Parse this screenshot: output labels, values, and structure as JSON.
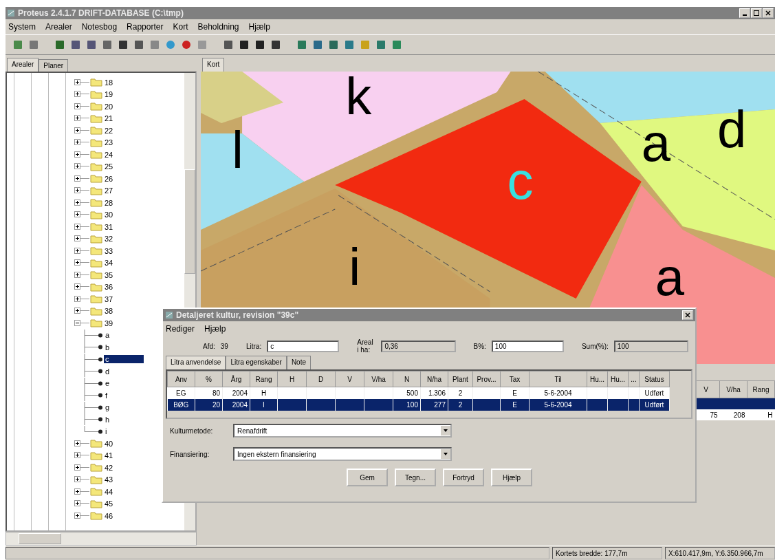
{
  "window": {
    "title": "Proteus 2.4.1.7 DRIFT-DATABASE (C:\\tmp)"
  },
  "menu": [
    "System",
    "Arealer",
    "Notesbog",
    "Rapporter",
    "Kort",
    "Beholdning",
    "Hjælp"
  ],
  "left_tabs": [
    {
      "label": "Arealer",
      "selected": true
    },
    {
      "label": "Planer",
      "selected": false
    }
  ],
  "tree": [
    {
      "label": "18",
      "expanded": false,
      "selected": false
    },
    {
      "label": "19",
      "expanded": false,
      "selected": false
    },
    {
      "label": "20",
      "expanded": false,
      "selected": false
    },
    {
      "label": "21",
      "expanded": false,
      "selected": false
    },
    {
      "label": "22",
      "expanded": false,
      "selected": false
    },
    {
      "label": "23",
      "expanded": false,
      "selected": false
    },
    {
      "label": "24",
      "expanded": false,
      "selected": false
    },
    {
      "label": "25",
      "expanded": false,
      "selected": false
    },
    {
      "label": "26",
      "expanded": false,
      "selected": false
    },
    {
      "label": "27",
      "expanded": false,
      "selected": false
    },
    {
      "label": "28",
      "expanded": false,
      "selected": false
    },
    {
      "label": "30",
      "expanded": false,
      "selected": false
    },
    {
      "label": "31",
      "expanded": false,
      "selected": false
    },
    {
      "label": "32",
      "expanded": false,
      "selected": false
    },
    {
      "label": "33",
      "expanded": false,
      "selected": false
    },
    {
      "label": "34",
      "expanded": false,
      "selected": false
    },
    {
      "label": "35",
      "expanded": false,
      "selected": false
    },
    {
      "label": "36",
      "expanded": false,
      "selected": false
    },
    {
      "label": "37",
      "expanded": false,
      "selected": false
    },
    {
      "label": "38",
      "expanded": false,
      "selected": false
    },
    {
      "label": "39",
      "expanded": true,
      "selected": false,
      "children": [
        {
          "label": "a",
          "selected": false
        },
        {
          "label": "b",
          "selected": false
        },
        {
          "label": "c",
          "selected": true
        },
        {
          "label": "d",
          "selected": false
        },
        {
          "label": "e",
          "selected": false
        },
        {
          "label": "f",
          "selected": false
        },
        {
          "label": "g",
          "selected": false
        },
        {
          "label": "h",
          "selected": false
        },
        {
          "label": "i",
          "selected": false
        }
      ]
    },
    {
      "label": "40",
      "expanded": false,
      "selected": false
    },
    {
      "label": "41",
      "expanded": false,
      "selected": false
    },
    {
      "label": "42",
      "expanded": false,
      "selected": false
    },
    {
      "label": "43",
      "expanded": false,
      "selected": false
    },
    {
      "label": "44",
      "expanded": false,
      "selected": false
    },
    {
      "label": "45",
      "expanded": false,
      "selected": false
    },
    {
      "label": "46",
      "expanded": false,
      "selected": false
    }
  ],
  "map_tabs": [
    {
      "label": "Kort",
      "selected": true
    }
  ],
  "map_labels": [
    "k",
    "l",
    "c",
    "a",
    "d",
    "a",
    "i"
  ],
  "side_table": {
    "columns": [
      "V",
      "V/ha",
      "Rang"
    ],
    "rows": [
      {
        "cells": [
          "",
          "",
          ""
        ],
        "selected": true
      },
      {
        "cells": [
          "75",
          "208",
          "H"
        ],
        "selected": false
      }
    ]
  },
  "dialog": {
    "title": "Detaljeret kultur, revision \"39c\"",
    "menu": [
      "Rediger",
      "Hjælp"
    ],
    "fields": [
      {
        "label": "Afd:",
        "value": "39",
        "kind": "text"
      },
      {
        "label": "Litra:",
        "value": "c",
        "kind": "input"
      },
      {
        "label": "Areal i ha:",
        "value": "0,36",
        "kind": "readonly"
      },
      {
        "label": "B%:",
        "value": "100",
        "kind": "input"
      },
      {
        "label": "Sum(%):",
        "value": "100",
        "kind": "readonly"
      }
    ],
    "tabs": [
      {
        "label": "Litra anvendelse",
        "selected": true
      },
      {
        "label": "Litra egenskaber",
        "selected": false
      },
      {
        "label": "Note",
        "selected": false
      }
    ],
    "table": {
      "columns": [
        "Anv",
        "%",
        "Årg",
        "Rang",
        "H",
        "D",
        "V",
        "V/ha",
        "N",
        "N/ha",
        "Plant",
        "Prov...",
        "Tax",
        "Til",
        "Hu...",
        "Hu...",
        "...",
        "Status"
      ],
      "rows": [
        {
          "cells": [
            "EG",
            "80",
            "2004",
            "H",
            "",
            "",
            "",
            "",
            "500",
            "1.306",
            "2",
            "",
            "E",
            "5-6-2004",
            "",
            "",
            "",
            "Udført"
          ],
          "selected": false
        },
        {
          "cells": [
            "BØG",
            "20",
            "2004",
            "I",
            "",
            "",
            "",
            "",
            "100",
            "277",
            "2",
            "",
            "E",
            "5-6-2004",
            "",
            "",
            "",
            "Udført"
          ],
          "selected": true
        }
      ]
    },
    "selects": [
      {
        "label": "Kulturmetode:",
        "value": "Renafdrift"
      },
      {
        "label": "Finansiering:",
        "value": "Ingen ekstern finansiering"
      }
    ],
    "buttons": [
      "Gem",
      "Tegn...",
      "Fortryd",
      "Hjælp"
    ]
  },
  "status_bar": [
    "Kortets bredde: 177,7m",
    "X:610.417,9m, Y:6.350.966,7m"
  ]
}
